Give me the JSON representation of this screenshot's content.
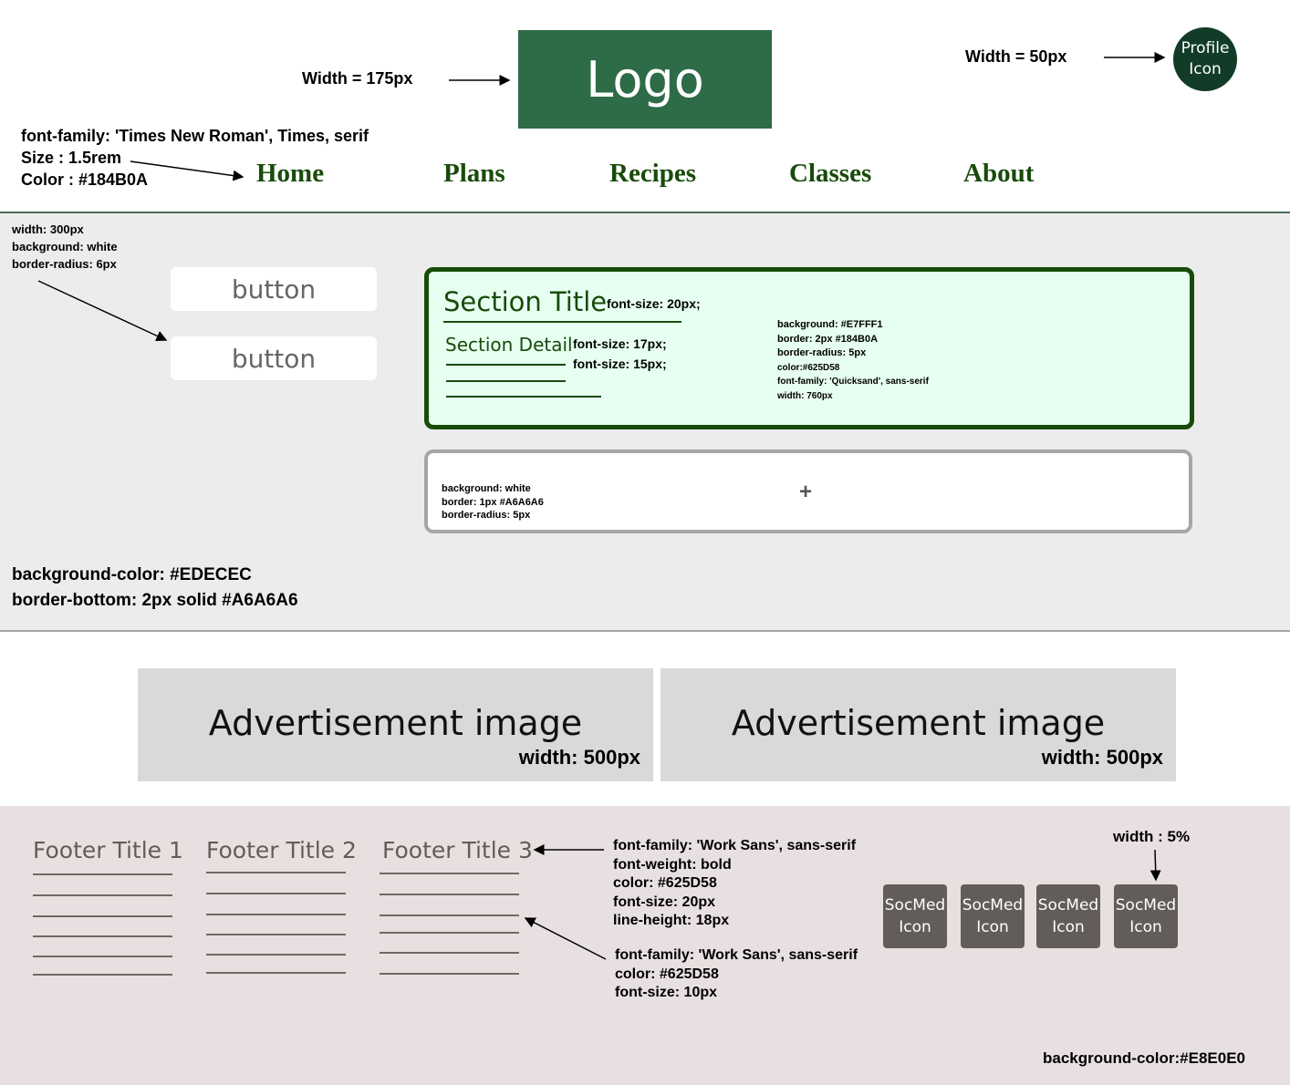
{
  "header": {
    "logo_text": "Logo",
    "logo_annotation": "Width = 175px",
    "profile_icon_line1": "Profile",
    "profile_icon_line2": "Icon",
    "profile_annotation": "Width = 50px",
    "nav_font_note": {
      "family": "font-family: 'Times New Roman', Times, serif",
      "size": "Size : 1.5rem",
      "color": "Color : #184B0A"
    },
    "nav_items": [
      "Home",
      "Plans",
      "Recipes",
      "Classes",
      "About"
    ]
  },
  "main": {
    "button_note": [
      "width: 300px",
      "background: white",
      "border-radius: 6px"
    ],
    "buttons": [
      "button",
      "button"
    ],
    "section_card": {
      "title": "Section Title",
      "title_note": "font-size: 20px;",
      "detail": "Section Detail",
      "detail_note": "font-size: 17px;",
      "line_note": "font-size: 15px;",
      "style_note": [
        "background: #E7FFF1",
        "border: 2px #184B0A",
        "border-radius: 5px",
        "color:#625D58",
        "font-family: 'Quicksand', sans-serif",
        "width: 760px"
      ]
    },
    "add_card": {
      "icon": "+",
      "style_note": [
        "background: white",
        "border: 1px #A6A6A6",
        "border-radius: 5px"
      ]
    },
    "band_note": [
      "background-color: #EDECEC",
      "border-bottom: 2px solid #A6A6A6"
    ]
  },
  "ads": [
    {
      "title": "Advertisement image",
      "width_note": "width: 500px"
    },
    {
      "title": "Advertisement image",
      "width_note": "width: 500px"
    }
  ],
  "footer": {
    "titles": [
      "Footer Title 1",
      "Footer Title 2",
      "Footer Title 3"
    ],
    "title_note": [
      "font-family: 'Work Sans', sans-serif",
      "font-weight: bold",
      "color: #625D58",
      "font-size: 20px",
      "line-height: 18px"
    ],
    "link_note": [
      "font-family: 'Work Sans', sans-serif",
      "color: #625D58",
      "font-size: 10px"
    ],
    "social_note": "width : 5%",
    "social_icons": [
      {
        "line1": "SocMed",
        "line2": "Icon"
      },
      {
        "line1": "SocMed",
        "line2": "Icon"
      },
      {
        "line1": "SocMed",
        "line2": "Icon"
      },
      {
        "line1": "SocMed",
        "line2": "Icon"
      }
    ],
    "bg_note": "background-color:#E8E0E0"
  },
  "colors": {
    "logo_bg": "#2E6B47",
    "profile_bg": "#123C28",
    "nav_text": "#184B0A",
    "main_bg": "#EDECEC",
    "card_bg": "#E7FFF1",
    "card_border": "#184B0A",
    "gray_border": "#A6A6A6",
    "ad_bg": "#D9D9D9",
    "footer_bg": "#E8E0E0",
    "footer_text": "#625D58"
  }
}
